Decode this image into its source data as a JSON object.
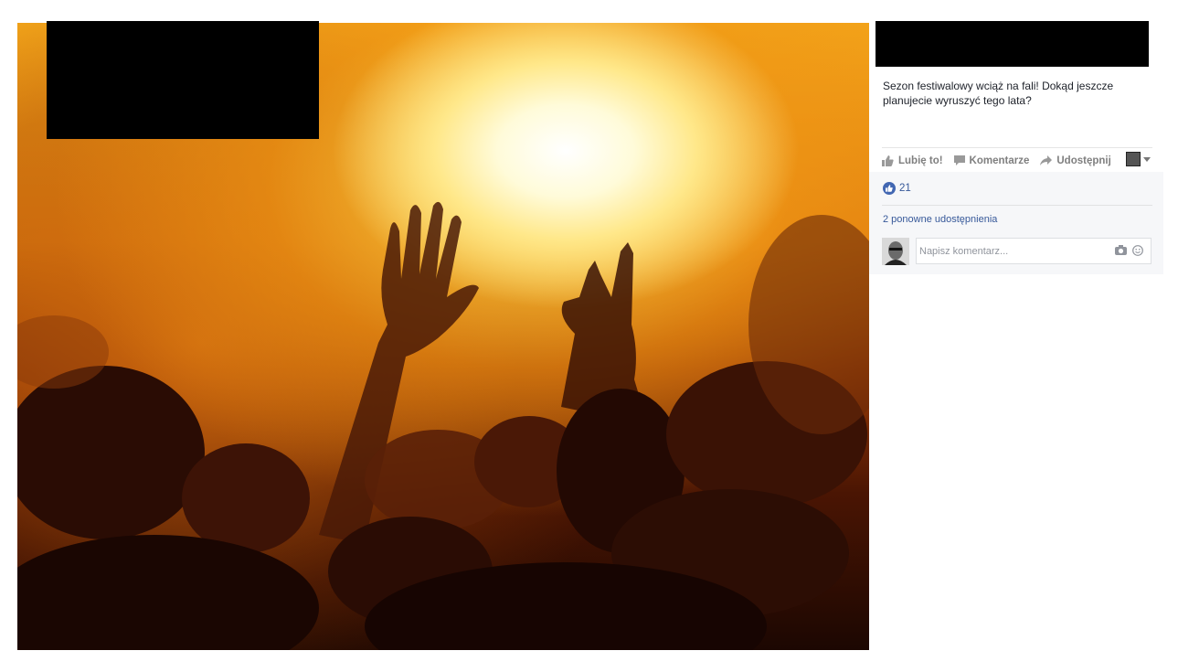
{
  "post": {
    "text": "Sezon festiwalowy wciąż na fali! Dokąd jeszcze planujecie wyruszyć tego lata?",
    "actions": {
      "like": "Lubię to!",
      "comment": "Komentarze",
      "share": "Udostępnij"
    },
    "like_count": "21",
    "shares_text": "2 ponowne udostępnienia",
    "comment_placeholder": "Napisz komentarz..."
  },
  "icons": [
    "thumbs-up-icon",
    "comment-icon",
    "share-icon",
    "camera-icon",
    "emoji-icon"
  ],
  "colors": {
    "link": "#365899",
    "like_blue": "#4267b2",
    "redaction": "#000000"
  }
}
